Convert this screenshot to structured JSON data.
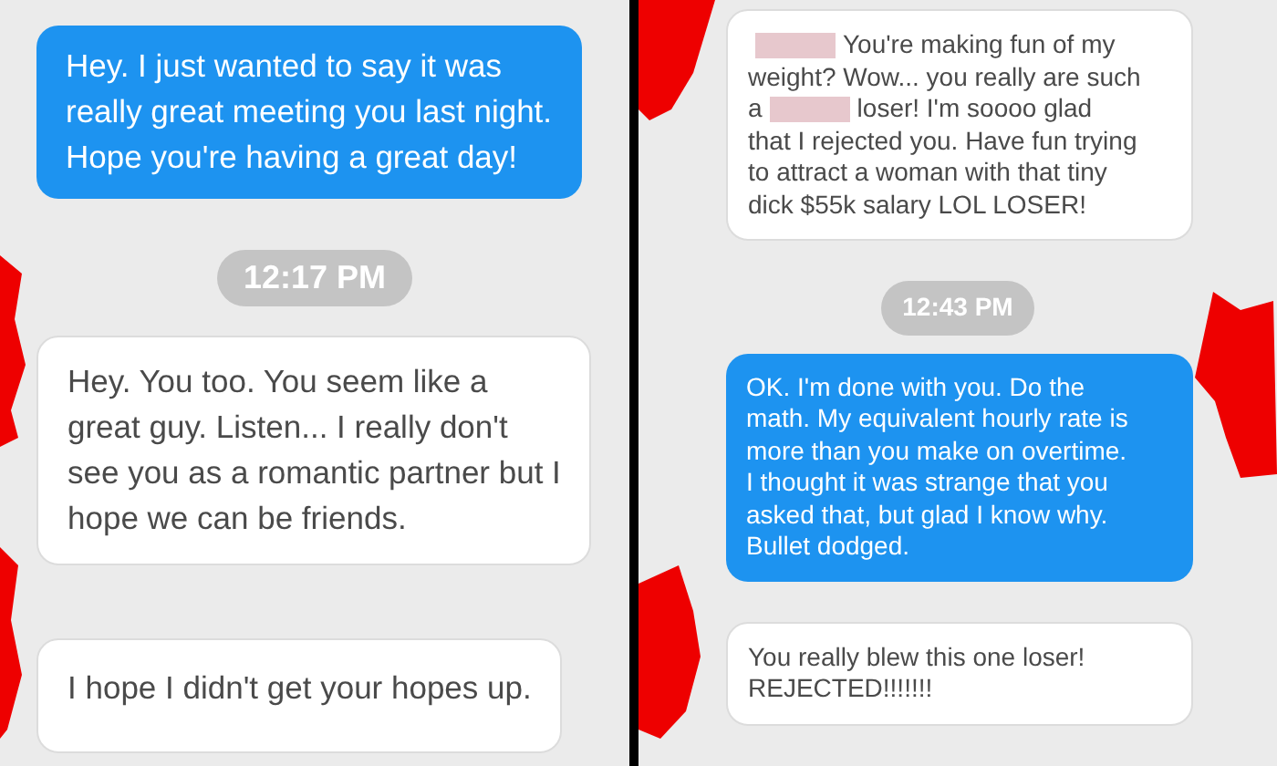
{
  "panels": [
    {
      "messages": [
        {
          "kind": "sent",
          "lines": [
            [
              {
                "kind": "text",
                "text": "Hey. I just wanted to say it was"
              }
            ],
            [
              {
                "kind": "text",
                "text": "really great meeting you last night."
              }
            ],
            [
              {
                "kind": "text",
                "text": "Hope you're having a great day!"
              }
            ]
          ]
        },
        {
          "kind": "time",
          "lines": [
            [
              {
                "kind": "text",
                "text": "12:17 PM"
              }
            ]
          ]
        },
        {
          "kind": "received",
          "lines": [
            [
              {
                "kind": "text",
                "text": "Hey. You too. You seem like a"
              }
            ],
            [
              {
                "kind": "text",
                "text": "great guy. Listen... I really don't"
              }
            ],
            [
              {
                "kind": "text",
                "text": "see you as a romantic partner but I"
              }
            ],
            [
              {
                "kind": "text",
                "text": "hope we can be friends."
              }
            ]
          ]
        },
        {
          "kind": "received",
          "lines": [
            [
              {
                "kind": "text",
                "text": "I hope I didn't get your hopes up."
              }
            ]
          ]
        }
      ]
    },
    {
      "messages": [
        {
          "kind": "received",
          "lines": [
            [
              {
                "kind": "redacted"
              },
              {
                "kind": "text",
                "text": "You're making fun of my"
              }
            ],
            [
              {
                "kind": "text",
                "text": "weight? Wow... you really are such"
              }
            ],
            [
              {
                "kind": "text",
                "text": "a"
              },
              {
                "kind": "redacted"
              },
              {
                "kind": "text",
                "text": "loser! I'm soooo glad"
              }
            ],
            [
              {
                "kind": "text",
                "text": "that I rejected you. Have fun trying"
              }
            ],
            [
              {
                "kind": "text",
                "text": "to attract a woman with that tiny"
              }
            ],
            [
              {
                "kind": "text",
                "text": "dick $55k salary LOL LOSER!"
              }
            ]
          ]
        },
        {
          "kind": "time",
          "lines": [
            [
              {
                "kind": "text",
                "text": "12:43 PM"
              }
            ]
          ]
        },
        {
          "kind": "sent",
          "lines": [
            [
              {
                "kind": "text",
                "text": "OK. I'm done with you. Do the"
              }
            ],
            [
              {
                "kind": "text",
                "text": "math. My equivalent hourly rate is"
              }
            ],
            [
              {
                "kind": "text",
                "text": "more than you make on overtime."
              }
            ],
            [
              {
                "kind": "text",
                "text": "I thought it was strange that you"
              }
            ],
            [
              {
                "kind": "text",
                "text": "asked that, but glad I know why."
              }
            ],
            [
              {
                "kind": "text",
                "text": "Bullet dodged."
              }
            ]
          ]
        },
        {
          "kind": "received",
          "lines": [
            [
              {
                "kind": "text",
                "text": "You really blew this one loser!"
              }
            ],
            [
              {
                "kind": "text",
                "text": "REJECTED!!!!!!!"
              }
            ]
          ]
        }
      ]
    }
  ]
}
